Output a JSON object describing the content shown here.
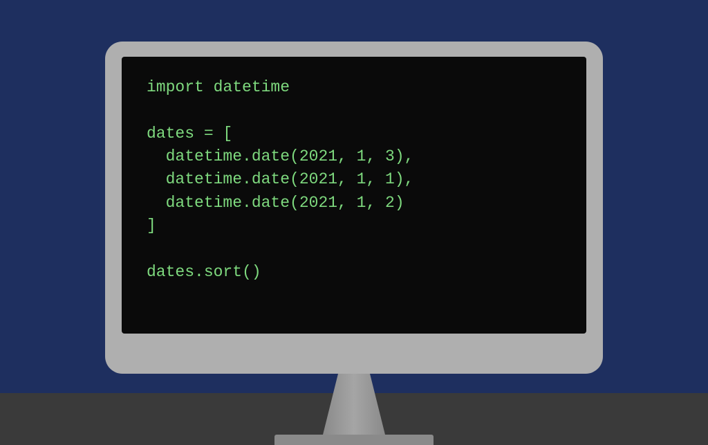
{
  "code": {
    "line1": "import datetime",
    "line2": "",
    "line3": "dates = [",
    "line4": "  datetime.date(2021, 1, 3),",
    "line5": "  datetime.date(2021, 1, 1),",
    "line6": "  datetime.date(2021, 1, 2)",
    "line7": "]",
    "line8": "",
    "line9": "dates.sort()"
  }
}
